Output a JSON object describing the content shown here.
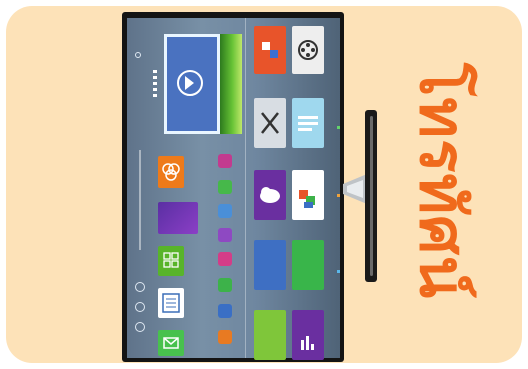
{
  "headline": "โทรทัศน์",
  "tv": {
    "screen_label": "dot-label",
    "left_panel_tiles": [
      {
        "name": "rings-app",
        "color": "#ee7a1a"
      },
      {
        "name": "purple-app",
        "color": "#7c3fb8"
      },
      {
        "name": "grid-app",
        "color": "#58b42a"
      },
      {
        "name": "news-app",
        "color": "#ffffff"
      },
      {
        "name": "mail-app",
        "color": "#48c14e"
      }
    ],
    "right_panel_tiles": [
      {
        "name": "contacts-app",
        "color": "#e8542a"
      },
      {
        "name": "film-reel-app",
        "color": "#eeeeee"
      },
      {
        "name": "tools-app",
        "color": "#d8dde3"
      },
      {
        "name": "document-app",
        "color": "#9fd8ee"
      },
      {
        "name": "cloud-app",
        "color": "#6a2fa0"
      },
      {
        "name": "shapes-app",
        "color": "#ffffff"
      },
      {
        "name": "blue-app",
        "color": "#3e6fc3"
      },
      {
        "name": "green-app",
        "color": "#39b54a"
      },
      {
        "name": "lime-app",
        "color": "#7fc63a"
      },
      {
        "name": "chart-app",
        "color": "#6a2fa0"
      }
    ],
    "accent_colors": {
      "headline": "#f06a1c",
      "card_background": "#fde2b8",
      "screen": "#6f87a0"
    }
  }
}
